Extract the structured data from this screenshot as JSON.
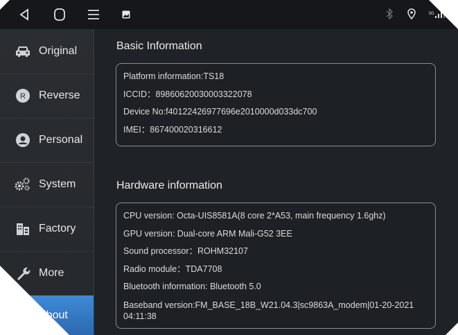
{
  "statusbar": {
    "nav": [
      "back-icon",
      "home-icon",
      "recents-icon"
    ],
    "notification_icon": "image-notification-icon",
    "status_icons": [
      "bluetooth-icon",
      "location-icon",
      "signal-icon"
    ],
    "signal_text": "3G"
  },
  "sidebar": {
    "items": [
      {
        "label": "Original",
        "icon": "car-icon"
      },
      {
        "label": "Reverse",
        "icon": "reverse-icon"
      },
      {
        "label": "Personal",
        "icon": "personal-icon"
      },
      {
        "label": "System",
        "icon": "gears-icon"
      },
      {
        "label": "Factory",
        "icon": "factory-icon"
      },
      {
        "label": "More",
        "icon": "wrench-icon"
      },
      {
        "label": "About",
        "icon": "",
        "active": true
      }
    ]
  },
  "basic": {
    "title": "Basic Information",
    "rows": [
      "Platform information:TS18",
      "ICCID：89860620030003322078",
      "Device No:f40122426977696e2010000d033dc700",
      "IMEI：867400020316612"
    ]
  },
  "hardware": {
    "title": "Hardware information",
    "rows": [
      "CPU version: Octa-UIS8581A(8 core 2*A53, main frequency 1.6ghz)",
      "GPU version: Dual-core ARM Mali-G52 3EE",
      "Sound processor：ROHM32107",
      "Radio module：TDA7708",
      "Bluetooth information: Bluetooth 5.0",
      "Baseband version:FM_BASE_18B_W21.04.3|sc9863A_modem|01-20-2021 04:11:38"
    ]
  },
  "colors": {
    "background": "#1f2226",
    "accent": "#3f8ad6",
    "panel_border": "#8a8d92"
  }
}
